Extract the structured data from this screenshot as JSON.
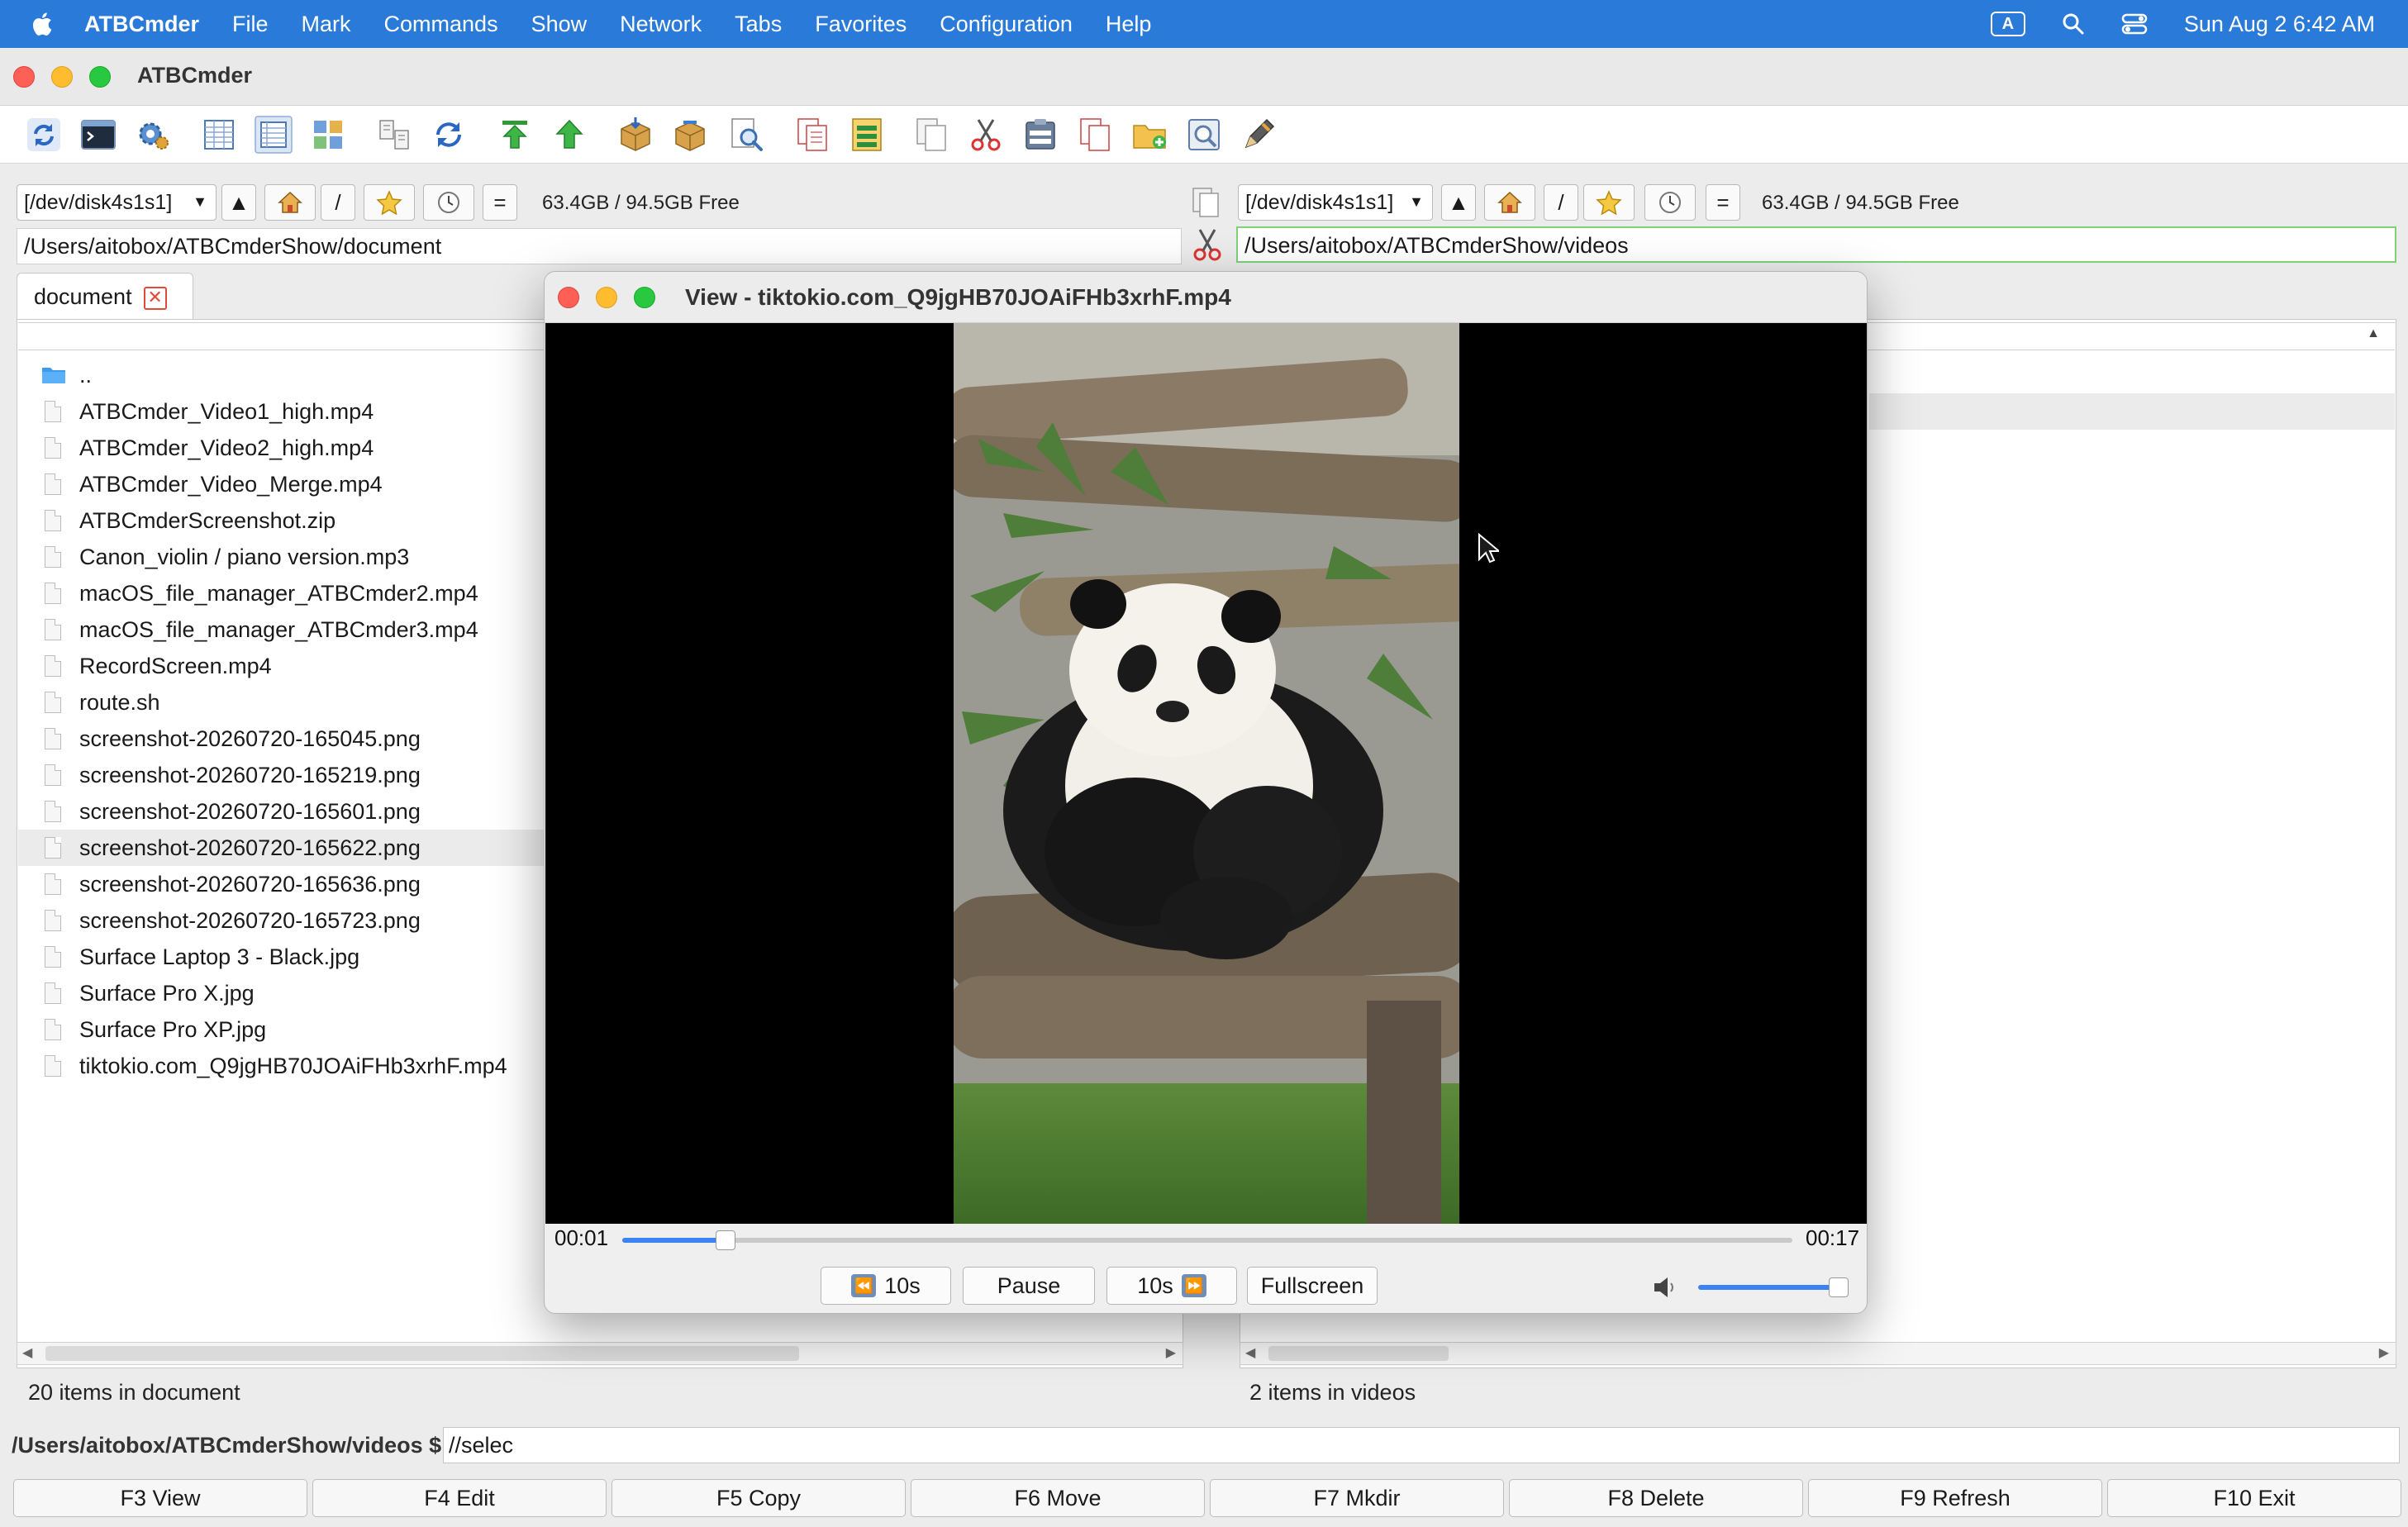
{
  "menubar": {
    "app": "ATBCmder",
    "items": [
      "File",
      "Mark",
      "Commands",
      "Show",
      "Network",
      "Tabs",
      "Favorites",
      "Configuration",
      "Help"
    ],
    "keyboard_badge": "A",
    "datetime": "Sun Aug 2  6:42 AM"
  },
  "window": {
    "title": "ATBCmder"
  },
  "toolbar": {
    "icons": [
      "refresh-icon",
      "terminal-icon",
      "settings-gear-icon",
      "brief-view-icon",
      "full-view-icon",
      "thumbnail-view-icon",
      "compare-dirs-icon",
      "sync-dirs-icon",
      "go-root-icon",
      "go-up-icon",
      "pack-icon",
      "unpack-icon",
      "search-files-icon",
      "copy-names-icon",
      "multi-rename-icon",
      "copy-icon",
      "cut-icon",
      "paste-icon",
      "duplicate-icon",
      "new-folder-icon",
      "view-file-icon",
      "edit-file-icon"
    ]
  },
  "left_panel": {
    "drive": "[/dev/disk4s1s1]",
    "free_space": "63.4GB / 94.5GB Free",
    "path": "/Users/aitobox/ATBCmderShow/document",
    "tab_label": "document",
    "files": [
      "..",
      "ATBCmder_Video1_high.mp4",
      "ATBCmder_Video2_high.mp4",
      "ATBCmder_Video_Merge.mp4",
      "ATBCmderScreenshot.zip",
      "Canon_violin / piano version.mp3",
      "macOS_file_manager_ATBCmder2.mp4",
      "macOS_file_manager_ATBCmder3.mp4",
      "RecordScreen.mp4",
      "route.sh",
      "screenshot-20260720-165045.png",
      "screenshot-20260720-165219.png",
      "screenshot-20260720-165601.png",
      "screenshot-20260720-165622.png",
      "screenshot-20260720-165636.png",
      "screenshot-20260720-165723.png",
      "Surface Laptop 3 - Black.jpg",
      "Surface Pro X.jpg",
      "Surface Pro XP.jpg",
      "tiktokio.com_Q9jgHB70JOAiFHb3xrhF.mp4"
    ],
    "selected_index": 13,
    "status": "20 items in document"
  },
  "right_panel": {
    "drive": "[/dev/disk4s1s1]",
    "free_space": "63.4GB / 94.5GB Free",
    "path": "/Users/aitobox/ATBCmderShow/videos",
    "status": "2 items in videos"
  },
  "drive_buttons": {
    "up": "▲",
    "root": "/",
    "equal": "="
  },
  "command_line": {
    "prompt": "/Users/aitobox/ATBCmderShow/videos $",
    "value": "//selec"
  },
  "function_keys": [
    "F3 View",
    "F4 Edit",
    "F5 Copy",
    "F6 Move",
    "F7 Mkdir",
    "F8 Delete",
    "F9 Refresh",
    "F10 Exit"
  ],
  "viewer": {
    "title": "View - tiktokio.com_Q9jgHB70JOAiFHb3xrhF.mp4",
    "current_time": "00:01",
    "duration": "00:17",
    "progress": 0.088,
    "buttons": {
      "rewind": "10s",
      "pause": "Pause",
      "forward": "10s",
      "fullscreen": "Fullscreen"
    },
    "rewind_icon": "⏪",
    "forward_icon": "⏩",
    "volume": 1.0
  }
}
